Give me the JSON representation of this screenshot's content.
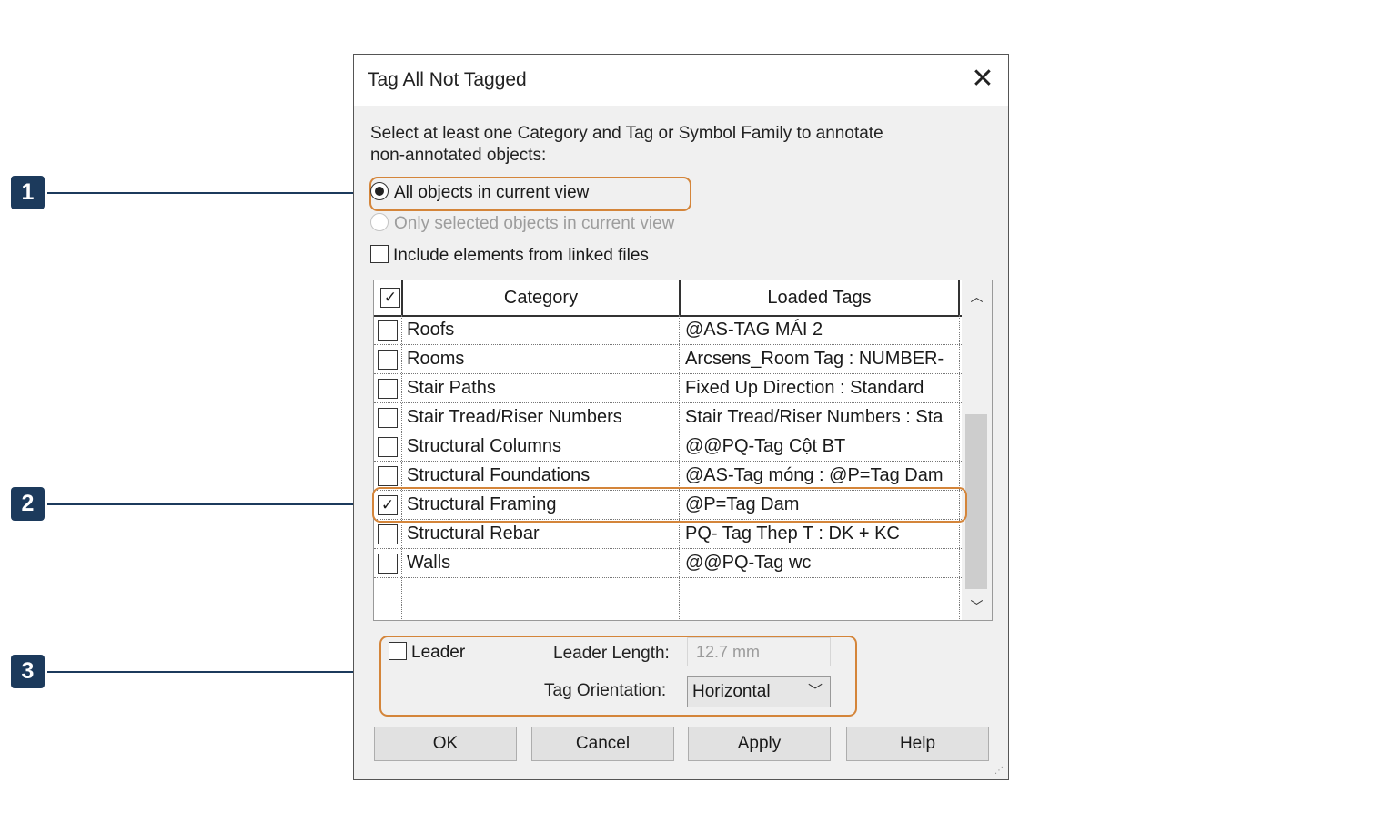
{
  "callouts": [
    {
      "num": "1"
    },
    {
      "num": "2"
    },
    {
      "num": "3"
    }
  ],
  "dialog": {
    "title": "Tag All Not Tagged",
    "instruction_line1": "Select at least one Category and Tag or Symbol Family to annotate",
    "instruction_line2": "non-annotated objects:",
    "radio_all": "All objects in current view",
    "radio_selected": "Only selected objects in current view",
    "include_linked": "Include elements from linked files",
    "table": {
      "header_category": "Category",
      "header_tags": "Loaded Tags",
      "header_checked": true,
      "rows": [
        {
          "category": "Roofs",
          "tag": "@AS-TAG MÁI 2",
          "checked": false
        },
        {
          "category": "Rooms",
          "tag": "Arcsens_Room Tag : NUMBER-",
          "checked": false
        },
        {
          "category": "Stair Paths",
          "tag": "Fixed Up Direction : Standard",
          "checked": false
        },
        {
          "category": "Stair Tread/Riser Numbers",
          "tag": "Stair Tread/Riser Numbers : Sta",
          "checked": false
        },
        {
          "category": "Structural Columns",
          "tag": "@@PQ-Tag Cột BT",
          "checked": false
        },
        {
          "category": "Structural Foundations",
          "tag": "@AS-Tag móng : @P=Tag Dam",
          "checked": false
        },
        {
          "category": "Structural Framing",
          "tag": "@P=Tag Dam",
          "checked": true
        },
        {
          "category": "Structural Rebar",
          "tag": "PQ- Tag Thep T : DK + KC",
          "checked": false
        },
        {
          "category": "Walls",
          "tag": "@@PQ-Tag wc",
          "checked": false
        }
      ]
    },
    "leader_label": "Leader",
    "leader_length_label": "Leader Length:",
    "leader_length_value": "12.7 mm",
    "tag_orientation_label": "Tag Orientation:",
    "tag_orientation_value": "Horizontal",
    "buttons": {
      "ok": "OK",
      "cancel": "Cancel",
      "apply": "Apply",
      "help": "Help"
    }
  },
  "colors": {
    "callout": "#1c3a5c",
    "highlight": "#d4853a"
  },
  "icons": [
    "close-icon",
    "scroll-up-icon",
    "scroll-down-icon",
    "chevron-down-icon",
    "check-icon",
    "resize-grip-icon"
  ]
}
